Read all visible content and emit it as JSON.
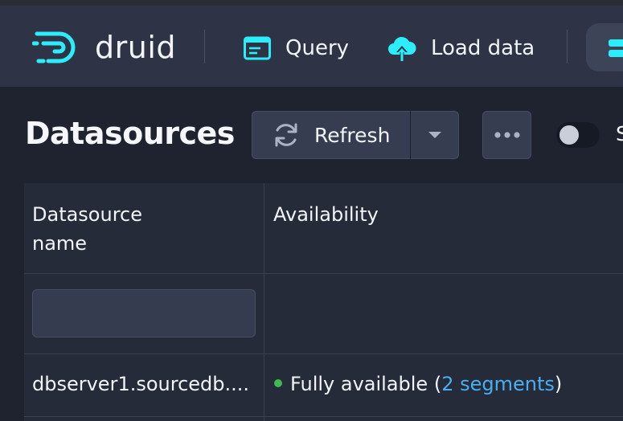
{
  "header": {
    "logo_text": "druid",
    "nav": [
      {
        "label": "Query",
        "icon": "application-icon"
      },
      {
        "label": "Load data",
        "icon": "cloud-upload-icon"
      }
    ]
  },
  "page": {
    "title": "Datasources",
    "refresh_label": "Refresh",
    "more_label": "•••",
    "toggle_label": "S"
  },
  "table": {
    "columns": [
      "Datasource name",
      "Availability"
    ],
    "column_lines": [
      [
        "Datasource",
        "name"
      ],
      [
        "Availability"
      ]
    ],
    "filter_placeholder": "",
    "rows": [
      {
        "datasource": "dbserver1.sourcedb....",
        "availability_text": "Fully available",
        "availability_open": "(",
        "segments_link": "2 segments",
        "availability_close": ")"
      }
    ]
  },
  "colors": {
    "brand_cyan": "#2ceefb",
    "link": "#48aff0",
    "available_dot": "#3fb950",
    "header_bg": "#2e3446",
    "page_bg": "#1f2330"
  }
}
